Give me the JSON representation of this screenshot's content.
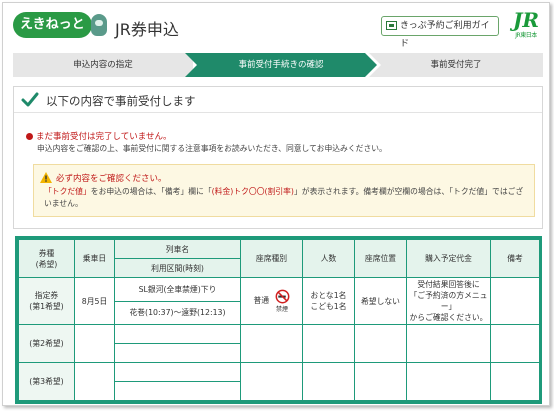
{
  "header": {
    "logo_text": "えきねっと",
    "app_title": "JR券申込",
    "guide_button": "きっぷ予約ご利用ガイド",
    "jr_mark": "JR",
    "jr_sub": "JR東日本"
  },
  "steps": [
    {
      "label": "申込内容の指定"
    },
    {
      "label": "事前受付手続きの確認"
    },
    {
      "label": "事前受付完了"
    }
  ],
  "confirm": {
    "title": "以下の内容で事前受付します",
    "status": "まだ事前受付は完了していません。",
    "description": "申込内容をご確認の上、事前受付に関する注意事項をお読みいただき、同意してお申込みください。"
  },
  "notice": {
    "title": "必ず内容をご確認ください。",
    "body_1": "「トクだ値」",
    "body_2": "をお申込の場合は、「備考」欄に「",
    "body_3": "(料金)トク〇〇(割引率)",
    "body_4": "」が表示されます。備考欄が空欄の場合は、「トクだ値」ではございません。"
  },
  "table": {
    "headers": {
      "preference": "券種\n(希望)",
      "date": "乗車日",
      "train_name": "列車名",
      "section": "利用区間(時刻)",
      "seat_type": "座席種別",
      "people": "人数",
      "seat_position": "座席位置",
      "price": "購入予定代金",
      "remarks": "備考"
    },
    "rows": [
      {
        "preference": "指定券\n(第1希望)",
        "date": "8月5日",
        "train": "SL銀河(全車禁煙)下り",
        "section": "花巻(10:37)～遠野(12:13)",
        "seat_type": "普通",
        "smoking": "禁煙",
        "people": "おとな1名\nこども1名",
        "seat_position": "希望しない",
        "price": "受付結果回答後に\n「ご予約済の方メニュー」\nからご確認ください。",
        "remarks": ""
      },
      {
        "preference": "(第2希望)"
      },
      {
        "preference": "(第3希望)"
      }
    ]
  }
}
